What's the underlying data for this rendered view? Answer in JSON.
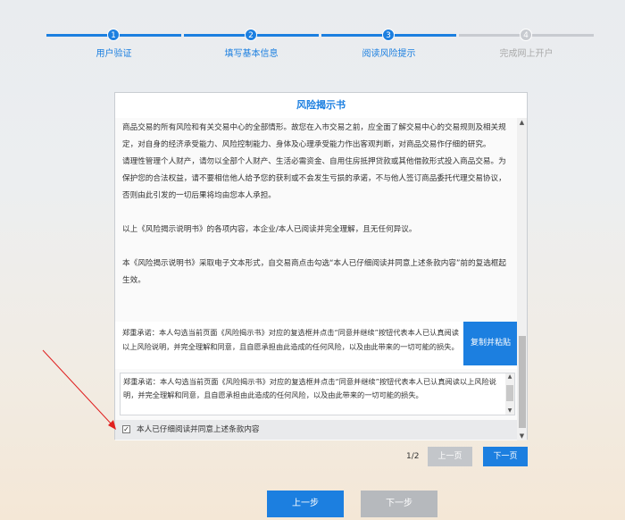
{
  "steps": [
    {
      "num": "1",
      "label": "用户验证",
      "active": true
    },
    {
      "num": "2",
      "label": "填写基本信息",
      "active": true
    },
    {
      "num": "3",
      "label": "阅读风险提示",
      "active": true
    },
    {
      "num": "4",
      "label": "完成网上开户",
      "active": false
    }
  ],
  "panel": {
    "title": "风险揭示书",
    "paragraphs": [
      "商品交易的所有风险和有关交易中心的全部情形。故您在入市交易之前，应全面了解交易中心的交易规则及相关规定，对自身的经济承受能力、风险控制能力、身体及心理承受能力作出客观判断，对商品交易作仔细的研究。",
      "请理性管理个人财产，请勿以全部个人财产、生活必需资金、自用住房抵押贷款或其他借款形式投入商品交易。为保护您的合法权益，请不要相信他人给予您的获利或不会发生亏损的承诺，不与他人签订商品委托代理交易协议，否则由此引发的一切后果将均由您本人承担。",
      "以上《风险揭示说明书》的各项内容，本企业/本人已阅读并完全理解，且无任何异议。",
      "本《风险揭示说明书》采取电子文本形式，自交易商点击勾选“本人已仔细阅读并同意上述条款内容”前的复选框起生效。"
    ],
    "promise_text": "郑重承诺：本人勾选当前页面《风险揭示书》对应的复选框并点击“同意并继续”按钮代表本人已认真阅读以上风险说明，并完全理解和同意，且自愿承担由此造成的任何风险，以及由此带来的一切可能的损失。",
    "copy_button": "复制并粘贴",
    "pasted_text": "郑重承诺：本人勾选当前页面《风险揭示书》对应的复选框并点击“同意并继续”按钮代表本人已认真阅读以上风险说明，并完全理解和同意，且自愿承担由此造成的任何风险，以及由此带来的一切可能的损失。",
    "agree_label": "本人已仔细阅读并同意上述条款内容",
    "agree_checked": "✓"
  },
  "pagination": {
    "info": "1/2",
    "prev": "上一页",
    "next": "下一页"
  },
  "nav": {
    "back": "上一步",
    "forward": "下一步"
  },
  "colors": {
    "accent": "#1c7fe0",
    "inactive": "#c8cbd0",
    "annotation": "#e02020"
  }
}
